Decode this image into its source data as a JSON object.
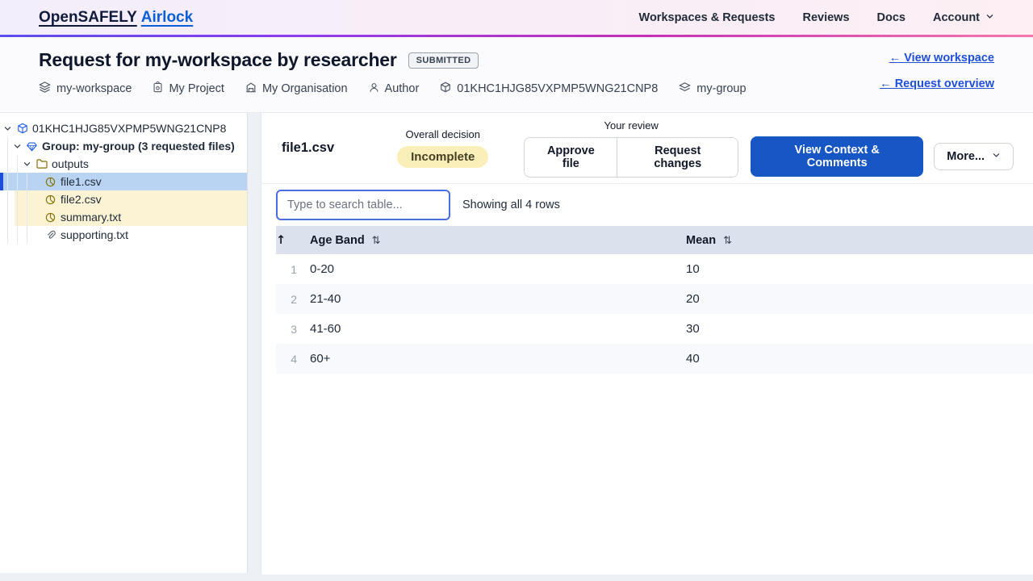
{
  "navbar": {
    "brand_part1": "OpenSAFELY",
    "brand_part2": "Airlock",
    "links": [
      "Workspaces & Requests",
      "Reviews",
      "Docs"
    ],
    "account_label": "Account"
  },
  "header": {
    "title": "Request for my-workspace by researcher",
    "status_badge": "SUBMITTED",
    "view_workspace_link": "← View workspace",
    "request_overview_link": "← Request overview",
    "meta": [
      {
        "icon": "layers-icon",
        "label": "my-workspace"
      },
      {
        "icon": "project-icon",
        "label": "My Project"
      },
      {
        "icon": "organisation-icon",
        "label": "My Organisation"
      },
      {
        "icon": "author-icon",
        "label": "Author"
      },
      {
        "icon": "request-id-icon",
        "label": "01KHC1HJG85VXPMP5WNG21CNP8"
      },
      {
        "icon": "group-icon",
        "label": "my-group"
      }
    ]
  },
  "tree": {
    "items": [
      {
        "label": "01KHC1HJG85VXPMP5WNG21CNP8",
        "type": "request-root",
        "state": "expanded"
      },
      {
        "label": "Group: my-group (3 requested files)",
        "type": "group",
        "state": "expanded"
      },
      {
        "label": "outputs",
        "type": "folder",
        "state": "expanded"
      },
      {
        "label": "file1.csv",
        "type": "output-file",
        "state": "selected"
      },
      {
        "label": "file2.csv",
        "type": "output-file",
        "state": "attention"
      },
      {
        "label": "summary.txt",
        "type": "output-file",
        "state": "attention"
      },
      {
        "label": "supporting.txt",
        "type": "supporting-file",
        "state": "default"
      }
    ]
  },
  "file_panel": {
    "file_name": "file1.csv",
    "overall_decision_label": "Overall decision",
    "decision_value": "Incomplete",
    "your_review_label": "Your review",
    "approve_file_button": "Approve file",
    "request_changes_button": "Request changes",
    "context_comments_button": "View Context & Comments",
    "more_button": "More...",
    "search_placeholder": "Type to search table...",
    "rows_summary": "Showing all 4 rows"
  },
  "table": {
    "sort_asc_icon": "↑",
    "sort_icon": "⇅",
    "columns": [
      "Age Band",
      "Mean"
    ],
    "rows": [
      {
        "n": "1",
        "age_band": "0-20",
        "mean": "10"
      },
      {
        "n": "2",
        "age_band": "21-40",
        "mean": "20"
      },
      {
        "n": "3",
        "age_band": "41-60",
        "mean": "30"
      },
      {
        "n": "4",
        "age_band": "60+",
        "mean": "40"
      }
    ]
  },
  "colors": {
    "brand_blue": "#0b5ed7",
    "primary_button_blue": "#1656c5",
    "selected_file_bg": "#b9d4f2",
    "attention_file_bg": "#fbf3d4",
    "decision_badge_bg": "#fbefb9",
    "table_header_bg": "#dbe2ed"
  }
}
